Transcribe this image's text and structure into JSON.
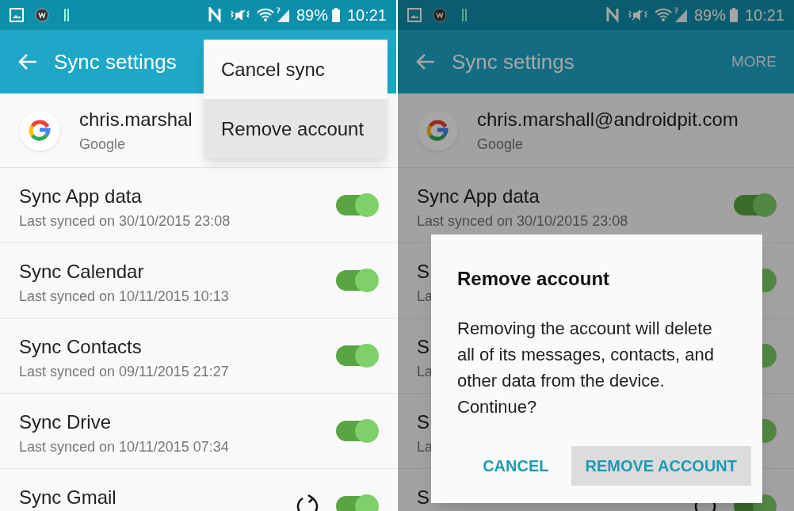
{
  "panels": [
    {
      "status_bar": {
        "battery": "89%",
        "time": "10:21"
      },
      "app_bar": {
        "title": "Sync settings"
      },
      "account": {
        "email": "chris.marshal",
        "provider": "Google"
      },
      "sync_items": [
        {
          "title": "Sync App data",
          "subtitle": "Last synced on 30/10/2015 23:08",
          "on": true,
          "syncing": false
        },
        {
          "title": "Sync Calendar",
          "subtitle": "Last synced on 10/11/2015 10:13",
          "on": true,
          "syncing": false
        },
        {
          "title": "Sync Contacts",
          "subtitle": "Last synced on 09/11/2015 21:27",
          "on": true,
          "syncing": false
        },
        {
          "title": "Sync Drive",
          "subtitle": "Last synced on 10/11/2015 07:34",
          "on": true,
          "syncing": false
        },
        {
          "title": "Sync Gmail",
          "on": true,
          "syncing": true
        }
      ],
      "menu": {
        "items": [
          {
            "label": "Cancel sync",
            "selected": false
          },
          {
            "label": "Remove account",
            "selected": true
          }
        ]
      }
    },
    {
      "status_bar": {
        "battery": "89%",
        "time": "10:21"
      },
      "app_bar": {
        "title": "Sync settings",
        "action": "MORE"
      },
      "account": {
        "email": "chris.marshall@androidpit.com",
        "provider": "Google"
      },
      "sync_items": [
        {
          "title": "Sync App data",
          "subtitle": "Last synced on 30/10/2015 23:08",
          "on": true,
          "syncing": false
        },
        {
          "title": "S",
          "subtitle": "La",
          "on": true,
          "syncing": false
        },
        {
          "title": "S",
          "subtitle": "La",
          "on": true,
          "syncing": false
        },
        {
          "title": "S",
          "subtitle": "La",
          "on": true,
          "syncing": false
        },
        {
          "title": "S",
          "on": true,
          "syncing": true
        }
      ],
      "dialog": {
        "title": "Remove account",
        "message": "Removing the account will delete all of its messages, contacts, and other data from the device. Continue?",
        "buttons": [
          {
            "label": "CANCEL",
            "selected": false
          },
          {
            "label": "REMOVE ACCOUNT",
            "selected": true
          }
        ]
      }
    }
  ]
}
